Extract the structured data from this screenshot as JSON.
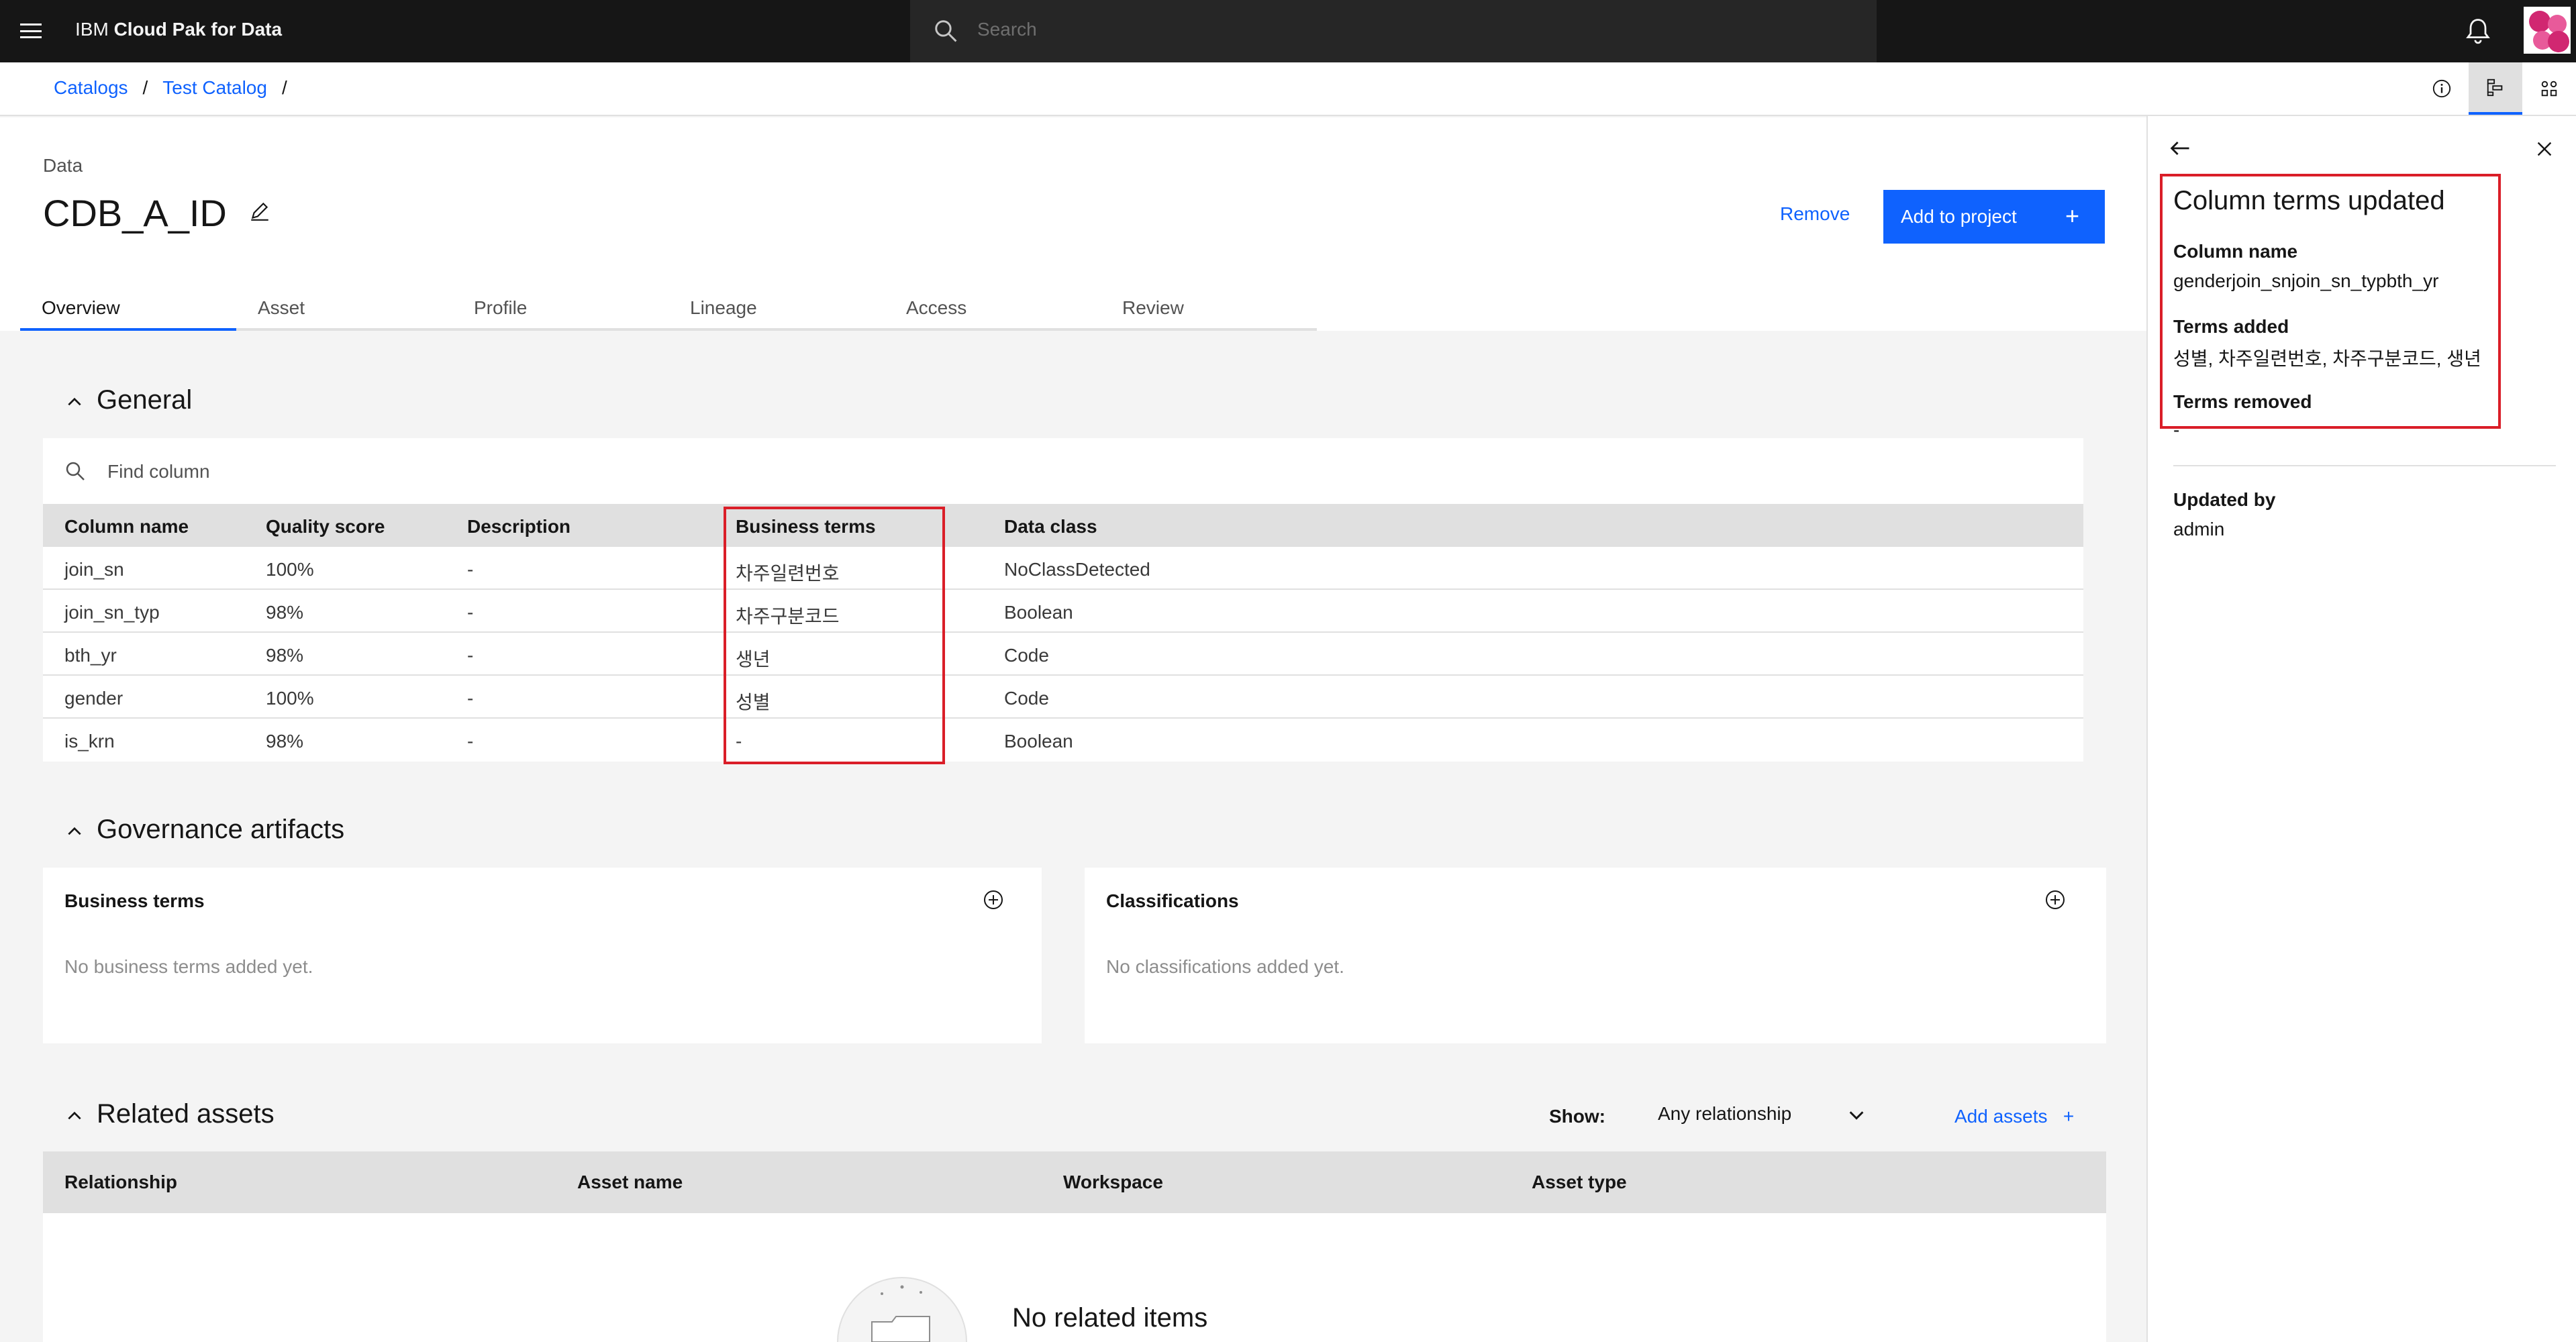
{
  "header": {
    "brand_prefix": "IBM ",
    "brand_name": "Cloud Pak for Data",
    "search_placeholder": "Search"
  },
  "breadcrumb": {
    "items": [
      "Catalogs",
      "Test Catalog"
    ],
    "separator": "/"
  },
  "asset": {
    "kind": "Data",
    "name": "CDB_A_ID",
    "remove_label": "Remove",
    "add_to_project_label": "Add to project",
    "add_icon": "+"
  },
  "tabs": [
    "Overview",
    "Asset",
    "Profile",
    "Lineage",
    "Access",
    "Review"
  ],
  "general": {
    "title": "General",
    "find_placeholder": "Find column",
    "columns": [
      "Column name",
      "Quality score",
      "Description",
      "Business terms",
      "Data class"
    ],
    "rows": [
      [
        "join_sn",
        "100%",
        "-",
        "차주일련번호",
        "NoClassDetected"
      ],
      [
        "join_sn_typ",
        "98%",
        "-",
        "차주구분코드",
        "Boolean"
      ],
      [
        "bth_yr",
        "98%",
        "-",
        "생년",
        "Code"
      ],
      [
        "gender",
        "100%",
        "-",
        "성별",
        "Code"
      ],
      [
        "is_krn",
        "98%",
        "-",
        "-",
        "Boolean"
      ]
    ]
  },
  "governance": {
    "title": "Governance artifacts",
    "business_terms_title": "Business terms",
    "business_terms_empty": "No business terms added yet.",
    "classifications_title": "Classifications",
    "classifications_empty": "No classifications added yet."
  },
  "related": {
    "title": "Related assets",
    "show_label": "Show:",
    "relationship_filter": "Any relationship",
    "add_assets_label": "Add assets",
    "add_icon": "+",
    "columns": [
      "Relationship",
      "Asset name",
      "Workspace",
      "Asset type"
    ],
    "empty_text": "No related items"
  },
  "panel": {
    "title": "Column terms updated",
    "column_name_label": "Column name",
    "column_name_value": "genderjoin_snjoin_sn_typbth_yr",
    "terms_added_label": "Terms added",
    "terms_added_value": "성별, 차주일련번호, 차주구분코드, 생년",
    "terms_removed_label": "Terms removed",
    "terms_removed_value": "-",
    "updated_by_label": "Updated by",
    "updated_by_value": "admin"
  },
  "colors": {
    "accent": "#0f62fe",
    "highlight": "#da1e28",
    "header_bg": "#161616"
  }
}
